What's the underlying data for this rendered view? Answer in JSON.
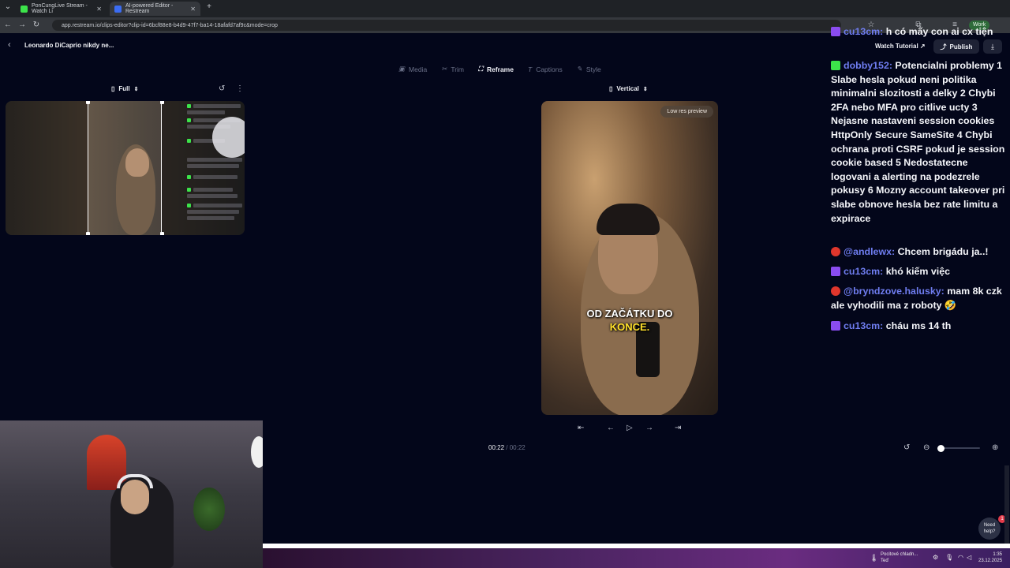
{
  "browser": {
    "tabs": [
      {
        "title": "PonCungLive Stream - Watch Li",
        "icon_color": "#3ce34a"
      },
      {
        "title": "AI-powered Editor - Restream",
        "icon_color": "#3b6cf2"
      }
    ],
    "new_tab": "+",
    "url": "app.restream.io/clips-editor?clip-id=6bcf88e8-b4d9-47f7-ba14-18afafd7af9c&mode=crop",
    "profile": "Work"
  },
  "editor": {
    "clip_title": "Leonardo DiCaprio nikdy ne...",
    "watch_tutorial": "Watch Tutorial",
    "publish": "Publish",
    "tabs": [
      {
        "label": "Media",
        "icon": "media-icon"
      },
      {
        "label": "Trim",
        "icon": "scissors-icon"
      },
      {
        "label": "Reframe",
        "icon": "reframe-icon"
      },
      {
        "label": "Captions",
        "icon": "text-icon"
      },
      {
        "label": "Style",
        "icon": "brush-icon"
      }
    ],
    "left_selector": "Full",
    "right_selector": "Vertical",
    "low_res": "Low res preview",
    "caption_line1": "OD ZAČÁTKU DO",
    "caption_line2": "KONCE.",
    "time_current": "00:22",
    "time_separator": "/",
    "time_total": "00:22"
  },
  "chat": [
    {
      "platform": "twitch",
      "user": "cu13cm:",
      "text": "h có mấy con ai cx tiện"
    },
    {
      "platform": "kick",
      "user": "dobby152:",
      "text": "Potencialni problemy 1 Slabe hesla pokud neni politika minimalni slozitosti a delky 2 Chybi 2FA nebo MFA pro citlive ucty 3 Nejasne nastaveni session cookies HttpOnly Secure SameSite 4 Chybi ochrana proti CSRF pokud je session cookie based 5 Nedostatecne logovani a alerting na podezrele pokusy 6 Mozny account takeover pri slabe obnove hesla bez rate limitu a expirace"
    },
    {
      "platform": "youtube",
      "user": "@andlewx:",
      "text": "Chcem brigádu ja..!"
    },
    {
      "platform": "twitch",
      "user": "cu13cm:",
      "text": "khó kiếm việc"
    },
    {
      "platform": "youtube",
      "user": "@bryndzove.halusky:",
      "text": "mam 8k czk ale vyhodili ma z roboty 🤣"
    },
    {
      "platform": "twitch",
      "user": "cu13cm:",
      "text": "cháu ms 14 th"
    }
  ],
  "help": {
    "line1": "Need",
    "line2": "help?",
    "badge": "1"
  },
  "taskbar": {
    "weather_line1": "Pocitové chladn...",
    "weather_line2": "Teď",
    "time": "1:35",
    "date": "23.12.2025"
  }
}
